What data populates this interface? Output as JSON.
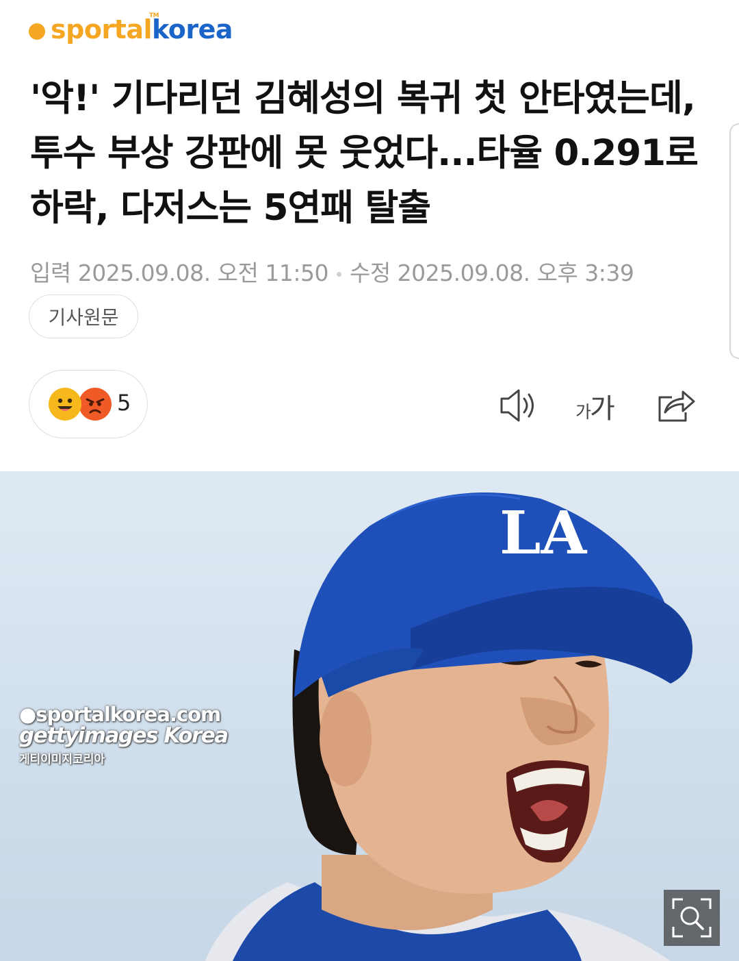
{
  "brand": {
    "logo_part1": "sportal",
    "logo_part2": "korea",
    "logo_tm": "TM"
  },
  "article": {
    "headline": "'악!' 기다리던 김혜성의 복귀 첫 안타였는데, 투수 부상 강판에 못 웃었다...타율 0.291로 하락, 다저스는 5연패 탈출",
    "published": "입력 2025.09.08. 오전 11:50",
    "modified": "수정 2025.09.08. 오후 3:39",
    "original_button": "기사원문"
  },
  "reactions": {
    "count": "5",
    "emojis": [
      "happy-face",
      "angry-face"
    ]
  },
  "toolbar": {
    "speaker_icon": "speaker-icon",
    "font_small": "가",
    "font_big": "가",
    "share_icon": "share-icon"
  },
  "photo": {
    "cap_logo": "LA",
    "watermark_line1": "●sportalkorea.com",
    "watermark_line2": "gettyimages Korea",
    "watermark_line3": "게티이미지코리아",
    "zoom_icon": "zoom-icon"
  },
  "colors": {
    "brand_orange": "#f5a623",
    "brand_blue": "#1b64c8",
    "cap_blue": "#1f4fb8"
  }
}
